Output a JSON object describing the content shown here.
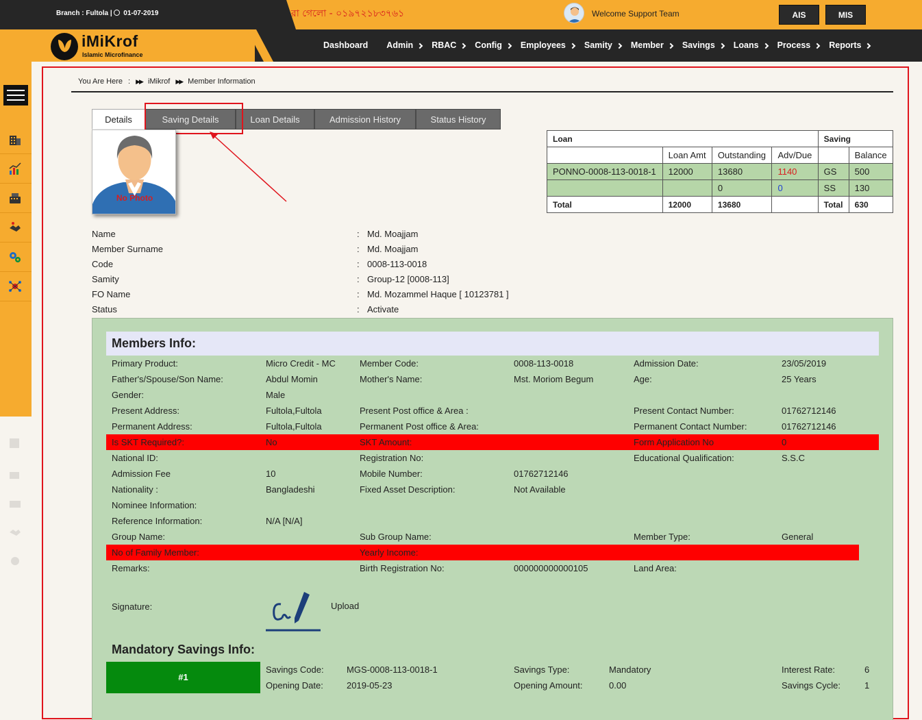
{
  "topbar": {
    "branch": "Branch : Fultola |",
    "date": "01-07-2019",
    "marquee": "রা গেলো - ০১৯৭২১৮৩৭৬১",
    "welcome": "Welcome Support Team",
    "btn_ais": "AIS",
    "btn_mis": "MIS"
  },
  "logo": {
    "name": "iMiKrof",
    "tagline": "Islamic Microfinance"
  },
  "nav": [
    {
      "label": "Dashboard",
      "chevron": false
    },
    {
      "label": "Admin",
      "chevron": true
    },
    {
      "label": "RBAC",
      "chevron": true
    },
    {
      "label": "Config",
      "chevron": true
    },
    {
      "label": "Employees",
      "chevron": true
    },
    {
      "label": "Samity",
      "chevron": true
    },
    {
      "label": "Member",
      "chevron": true
    },
    {
      "label": "Savings",
      "chevron": true
    },
    {
      "label": "Loans",
      "chevron": true
    },
    {
      "label": "Process",
      "chevron": true
    },
    {
      "label": "Reports",
      "chevron": true
    }
  ],
  "breadcrumb": {
    "prefix": "You Are Here",
    "colon": ":",
    "items": [
      "iMikrof",
      "Member Information"
    ]
  },
  "tabs": [
    "Details",
    "Saving Details",
    "Loan Details",
    "Admission History",
    "Status History"
  ],
  "photo": {
    "placeholder": "No Photo"
  },
  "summary": {
    "loan_header": "Loan",
    "saving_header": "Saving",
    "cols": [
      "Loan Amt",
      "Outstanding",
      "Adv/Due",
      "",
      "Balance"
    ],
    "rows": [
      {
        "code": "PONNO-0008-113-0018-1",
        "amt": "12000",
        "outstanding": "13680",
        "advdue": "1140",
        "stype": "GS",
        "balance": "500"
      },
      {
        "code": "",
        "amt": "",
        "outstanding": "0",
        "advdue": "0",
        "stype": "SS",
        "balance": "130"
      }
    ],
    "total": {
      "label": "Total",
      "amt": "12000",
      "outstanding": "13680",
      "slabel": "Total",
      "balance": "630"
    }
  },
  "basic": [
    {
      "label": "Name",
      "value": "Md. Moajjam"
    },
    {
      "label": "Member Surname",
      "value": "Md. Moajjam"
    },
    {
      "label": "Code",
      "value": "0008-113-0018"
    },
    {
      "label": "Samity",
      "value": "Group-12 [0008-113]"
    },
    {
      "label": "FO Name",
      "value": "Md. Mozammel Haque [ 10123781 ]"
    },
    {
      "label": "Status",
      "value": "Activate"
    }
  ],
  "members_info": {
    "title": "Members Info:",
    "r1": [
      "Primary Product:",
      "Micro Credit - MC",
      "Member Code:",
      "0008-113-0018",
      "Admission Date:",
      "23/05/2019"
    ],
    "r2": [
      "Father's/Spouse/Son Name:",
      "Abdul Momin",
      "Mother's Name:",
      "Mst. Moriom Begum",
      "Age:",
      "25 Years"
    ],
    "r3": [
      "Gender:",
      "Male",
      "",
      "",
      "",
      ""
    ],
    "r4": [
      "Present Address:",
      "Fultola,Fultola",
      "Present Post office & Area :",
      "",
      "Present Contact Number:",
      "01762712146"
    ],
    "r5": [
      "Permanent Address:",
      "Fultola,Fultola",
      "Permanent Post office & Area:",
      "",
      "Permanent Contact Number:",
      "01762712146"
    ],
    "r6": [
      "Is SKT Required?:",
      "No",
      "SKT Amount:",
      "",
      "Form Application No",
      "0"
    ],
    "r7": [
      "National ID:",
      "",
      "Registration No:",
      "",
      "Educational Qualification:",
      "S.S.C"
    ],
    "r8": [
      "Admission Fee",
      "10",
      "Mobile Number:",
      "01762712146",
      "",
      ""
    ],
    "r9": [
      "Nationality :",
      "Bangladeshi",
      "Fixed Asset Description:",
      "Not Available",
      "",
      ""
    ],
    "r10": [
      "Nominee Information:",
      "",
      "",
      "",
      "",
      ""
    ],
    "r11": [
      "Reference Information:",
      "N/A [N/A]",
      "",
      "",
      "",
      ""
    ],
    "r12": [
      "Group Name:",
      "",
      "Sub Group Name:",
      "",
      "Member Type:",
      "General"
    ],
    "r13": [
      "No of Family Member:",
      "",
      "Yearly Income:",
      "",
      "",
      ""
    ],
    "r14": [
      "Remarks:",
      "",
      "Birth Registration No:",
      "000000000000105",
      "Land Area:",
      ""
    ],
    "signature_label": "Signature:",
    "upload_label": "Upload"
  },
  "mandatory": {
    "title": "Mandatory Savings Info:",
    "badge": "#1",
    "savings_code_label": "Savings Code:",
    "savings_code": "MGS-0008-113-0018-1",
    "opening_date_label": "Opening Date:",
    "opening_date": "2019-05-23",
    "savings_type_label": "Savings Type:",
    "savings_type": "Mandatory",
    "opening_amount_label": "Opening Amount:",
    "opening_amount": "0.00",
    "interest_rate_label": "Interest Rate:",
    "interest_rate": "6",
    "savings_cycle_label": "Savings Cycle:",
    "savings_cycle": "1"
  },
  "colors": {
    "brand_orange": "#f6ab2f",
    "dark": "#262626",
    "panel_green": "#bcd8b5",
    "alert_red": "#fe0000",
    "badge_green": "#058a0d"
  }
}
